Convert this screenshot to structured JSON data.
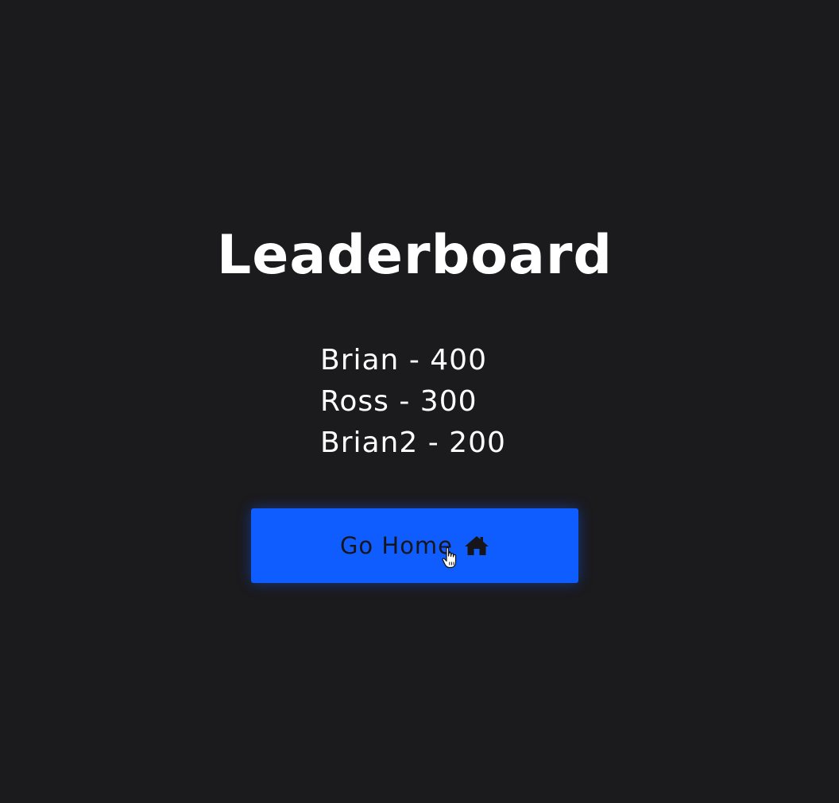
{
  "page": {
    "title": "Leaderboard"
  },
  "leaderboard": {
    "entries": [
      {
        "text": "Brian - 400"
      },
      {
        "text": "Ross - 300"
      },
      {
        "text": "Brian2 - 200"
      }
    ]
  },
  "actions": {
    "go_home_label": "Go Home",
    "go_home_icon": "home-icon"
  },
  "colors": {
    "background": "#1b1a1c",
    "text": "#ffffff",
    "accent": "#0f5cff",
    "button_text": "#16161a"
  },
  "cursor": {
    "icon": "hand-pointer-icon"
  }
}
